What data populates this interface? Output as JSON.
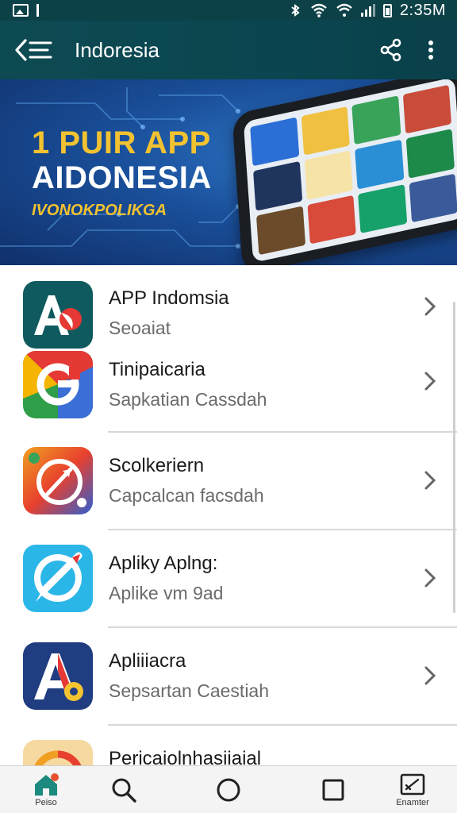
{
  "status_bar": {
    "time": "2:35M"
  },
  "app_bar": {
    "title": "Indoresia"
  },
  "banner": {
    "headline_line1": "1 PUIR APP",
    "headline_line2": "AIDONESIA",
    "subline": "IVONOKPOLIKGA"
  },
  "apps": [
    {
      "title": "APP Indomsia",
      "subtitle": "Seoaiat"
    },
    {
      "title": "Tinipaicaria",
      "subtitle": "Sapkatian Cassdah"
    },
    {
      "title": "Scolkeriern",
      "subtitle": "Capcalcan facsdah"
    },
    {
      "title": "Apliky Aplng:",
      "subtitle": "Aplike vm 9ad"
    },
    {
      "title": "Apliiiacra",
      "subtitle": "Sepsartan Caestiah"
    },
    {
      "title": "Pericaiolnhasiiaial",
      "subtitle": ""
    }
  ],
  "bottom_nav": {
    "items": [
      {
        "label": "Peiso",
        "icon": "home-icon"
      },
      {
        "label": "",
        "icon": "search-icon"
      },
      {
        "label": "",
        "icon": "circle-home-icon"
      },
      {
        "label": "",
        "icon": "square-recents-icon"
      },
      {
        "label": "Enamter",
        "icon": "edit-window-icon"
      }
    ]
  },
  "colors": {
    "app_bar": "#0e4a52",
    "banner_yellow": "#f2c230",
    "banner_blue": "#1a4f9a"
  }
}
